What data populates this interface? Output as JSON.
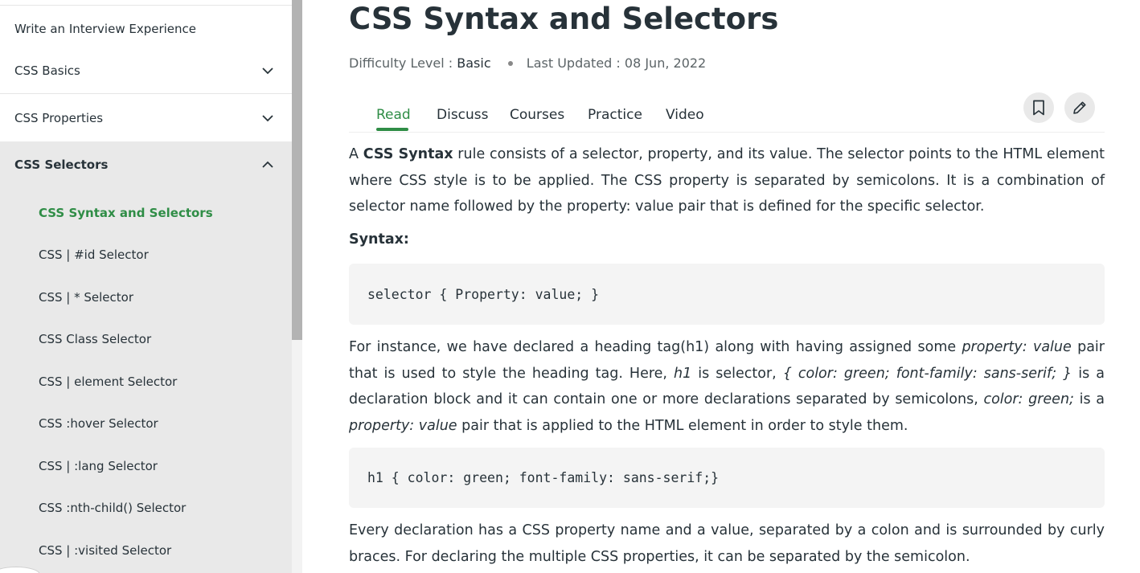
{
  "sidebar": {
    "write_experience": "Write an Interview Experience",
    "sections": [
      {
        "label": "CSS Basics",
        "expanded": false
      },
      {
        "label": "CSS Properties",
        "expanded": false
      },
      {
        "label": "CSS Selectors",
        "expanded": true
      }
    ],
    "sub_items": [
      {
        "label": "CSS Syntax and Selectors",
        "active": true
      },
      {
        "label": "CSS | #id Selector",
        "active": false
      },
      {
        "label": "CSS | * Selector",
        "active": false
      },
      {
        "label": "CSS Class Selector",
        "active": false
      },
      {
        "label": "CSS | element Selector",
        "active": false
      },
      {
        "label": "CSS :hover Selector",
        "active": false
      },
      {
        "label": "CSS | :lang Selector",
        "active": false
      },
      {
        "label": "CSS :nth-child() Selector",
        "active": false
      },
      {
        "label": "CSS | :visited Selector",
        "active": false
      }
    ]
  },
  "article": {
    "title": "CSS Syntax and Selectors",
    "difficulty_label": "Difficulty Level :",
    "difficulty_value": "Basic",
    "updated_label": "Last Updated :",
    "updated_value": "08 Jun, 2022",
    "tabs": [
      "Read",
      "Discuss",
      "Courses",
      "Practice",
      "Video"
    ],
    "active_tab": "Read",
    "toolbar_icons": [
      "bookmark-icon",
      "edit-pencil-icon"
    ],
    "p1": {
      "a": "A ",
      "bold": "CSS Syntax",
      "b": " rule consists of a selector, property, and its value. The selector points to the HTML element where CSS style is to be applied. The CSS property is separated by semicolons. It is a combination of selector name followed by the property: value pair that is defined for the specific selector."
    },
    "syntax_label": "Syntax:",
    "code1": "selector { Property: value; }",
    "p2": {
      "a": "For instance, we have declared a heading tag(h1) along with having assigned some ",
      "i1": "property: value",
      "b": " pair that is used to style the heading tag. Here, ",
      "i2": "h1",
      "c": " is selector, ",
      "i3": "{ color: green; font-family: sans-serif; }",
      "d": " is a declaration block and it can contain one or more declarations separated by semicolons, ",
      "i4": "color: green;",
      "e": " is a ",
      "i5": "property: value",
      "f": " pair that is applied to the HTML element in order to style them."
    },
    "code2": "h1 { color: green; font-family: sans-serif;}",
    "p3": "Every declaration has a CSS property name and a value, separated by a colon and is surrounded by curly braces. For declaring the multiple CSS properties, it can be separated by the semicolon."
  },
  "colors": {
    "accent_green": "#2f8d46",
    "text": "#273239",
    "sidebar_active_bg": "#e9e9e9",
    "code_bg": "#f4f4f4"
  }
}
